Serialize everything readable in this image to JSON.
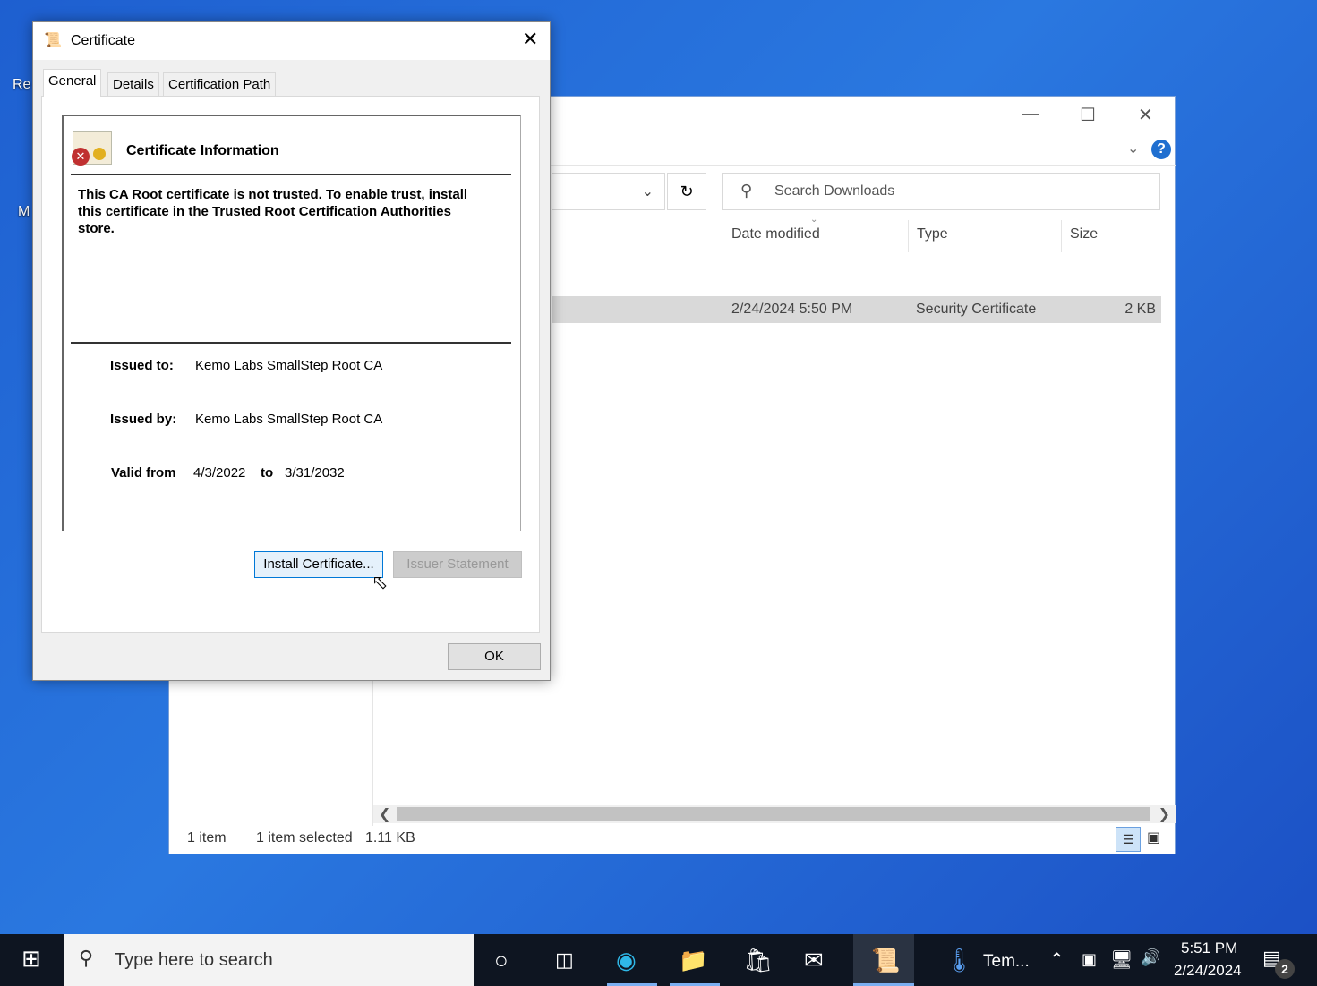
{
  "desktop": {
    "icons": [
      "Re",
      "M"
    ]
  },
  "explorer": {
    "search_placeholder": "Search Downloads",
    "columns": [
      "Date modified",
      "Type",
      "Size"
    ],
    "file": {
      "date": "2/24/2024 5:50 PM",
      "type": "Security Certificate",
      "size": "2 KB"
    },
    "status": {
      "count": "1 item",
      "selected": "1 item selected",
      "size": "1.11 KB"
    }
  },
  "dialog": {
    "title": "Certificate",
    "tabs": [
      "General",
      "Details",
      "Certification Path"
    ],
    "heading": "Certificate Information",
    "message": "This CA Root certificate is not trusted. To enable trust, install this certificate in the Trusted Root Certification Authorities store.",
    "issued_to_label": "Issued to:",
    "issued_to": "Kemo Labs SmallStep Root CA",
    "issued_by_label": "Issued by:",
    "issued_by": "Kemo Labs SmallStep Root CA",
    "valid_from_label": "Valid from",
    "valid_from": "4/3/2022",
    "to_label": "to",
    "valid_to": "3/31/2032",
    "install_button": "Install Certificate...",
    "issuer_button": "Issuer Statement",
    "ok_button": "OK"
  },
  "taskbar": {
    "search_placeholder": "Type here to search",
    "weather": "Tem...",
    "time": "5:51 PM",
    "date": "2/24/2024",
    "notifications": "2"
  }
}
